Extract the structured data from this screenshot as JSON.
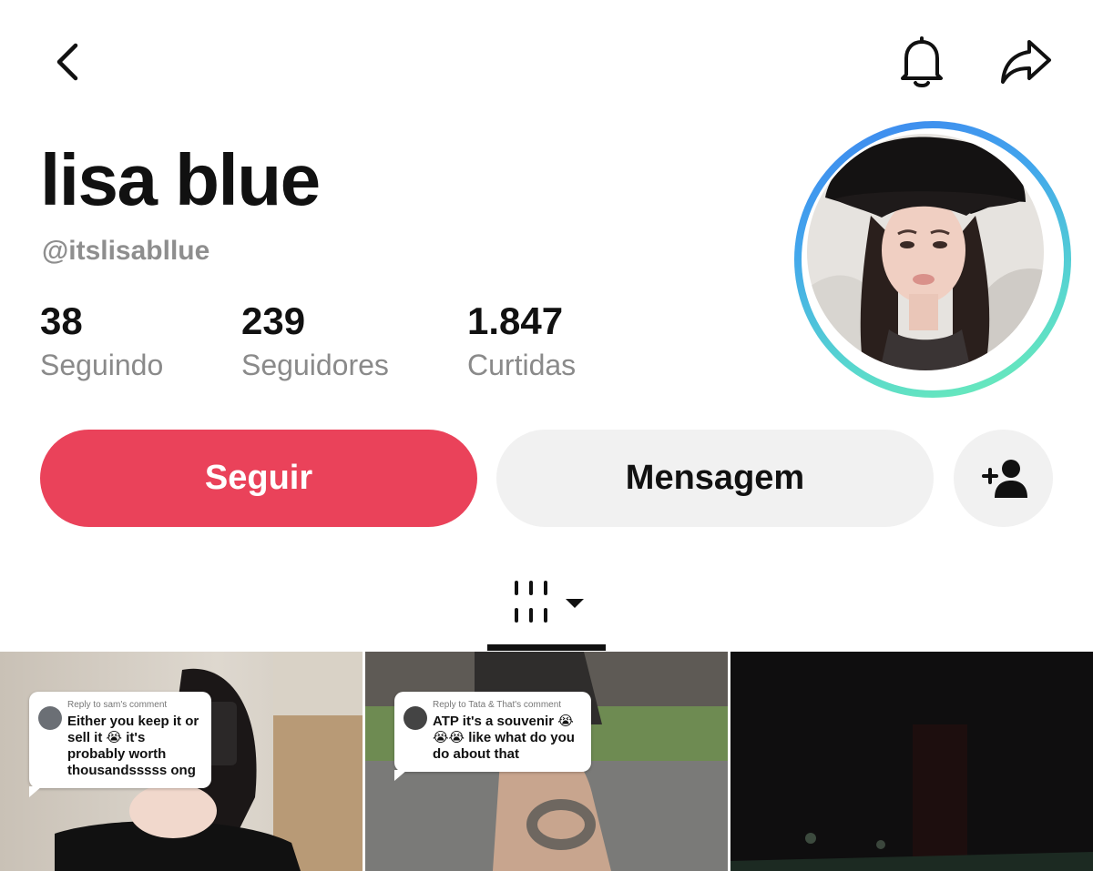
{
  "header": {
    "back_icon": "chevron-left-icon",
    "notification_icon": "bell-icon",
    "share_icon": "share-arrow-icon"
  },
  "profile": {
    "display_name": "lisa blue",
    "username": "@itslisabllue",
    "avatar_ring_colors": [
      "#3d84f0",
      "#6ef0b4"
    ],
    "stats": [
      {
        "value": "38",
        "label": "Seguindo"
      },
      {
        "value": "239",
        "label": "Seguidores"
      },
      {
        "value": "1.847",
        "label": "Curtidas"
      }
    ]
  },
  "actions": {
    "follow_label": "Seguir",
    "message_label": "Mensagem",
    "add_friend_icon": "add-user-icon",
    "follow_color": "#ea425a"
  },
  "tabs": {
    "videos_icon": "videos-grid-icon",
    "dropdown_icon": "caret-down-icon"
  },
  "videos": [
    {
      "reply_header": "Reply to sam's comment",
      "comment": "Either you keep it or sell it 😭 it's probably worth thousandsssss ong"
    },
    {
      "reply_header": "Reply to Tata & That's comment",
      "comment": "ATP it's a souvenir 😭😭😭 like what do you do about that"
    },
    {
      "reply_header": "",
      "comment": ""
    }
  ]
}
